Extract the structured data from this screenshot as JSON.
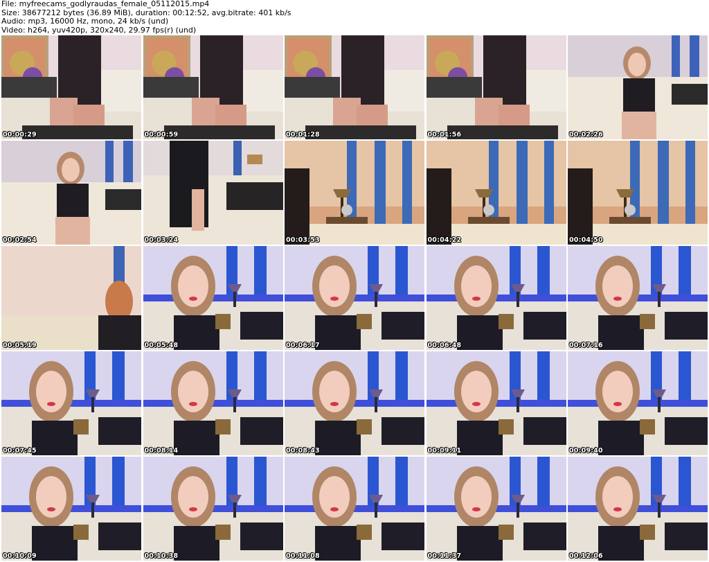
{
  "header": {
    "line1": "File: myfreecams_godlyraudas_female_05112015.mp4",
    "line2": "Size: 38677212 bytes (36.89 MiB), duration: 00:12:52, avg.bitrate: 401 kb/s",
    "line3": "Audio: mp3, 16000 Hz, mono, 24 kb/s (und)",
    "line4": "Video: h264, yuv420p, 320x240, 29.97 fps(r) (und)"
  },
  "thumbnails": [
    {
      "time": "00:00:29",
      "scene": "poster-couch"
    },
    {
      "time": "00:00:59",
      "scene": "poster-couch"
    },
    {
      "time": "00:01:28",
      "scene": "poster-couch"
    },
    {
      "time": "00:01:56",
      "scene": "poster-couch"
    },
    {
      "time": "00:02:26",
      "scene": "couch-seated"
    },
    {
      "time": "00:02:54",
      "scene": "couch-seated"
    },
    {
      "time": "00:03:24",
      "scene": "couch-standing"
    },
    {
      "time": "00:03:53",
      "scene": "wall-lamp"
    },
    {
      "time": "00:04:22",
      "scene": "wall-lamp"
    },
    {
      "time": "00:04:50",
      "scene": "wall-lamp"
    },
    {
      "time": "00:05:19",
      "scene": "curtain-couch"
    },
    {
      "time": "00:05:48",
      "scene": "blue-closeup"
    },
    {
      "time": "00:06:17",
      "scene": "blue-closeup"
    },
    {
      "time": "00:06:48",
      "scene": "blue-closeup"
    },
    {
      "time": "00:07:16",
      "scene": "blue-closeup"
    },
    {
      "time": "00:07:45",
      "scene": "blue-closeup"
    },
    {
      "time": "00:08:14",
      "scene": "blue-closeup"
    },
    {
      "time": "00:08:43",
      "scene": "blue-closeup"
    },
    {
      "time": "00:09:11",
      "scene": "blue-closeup"
    },
    {
      "time": "00:09:40",
      "scene": "blue-closeup"
    },
    {
      "time": "00:10:09",
      "scene": "blue-closeup"
    },
    {
      "time": "00:10:38",
      "scene": "blue-closeup"
    },
    {
      "time": "00:11:08",
      "scene": "blue-closeup"
    },
    {
      "time": "00:11:37",
      "scene": "blue-closeup"
    },
    {
      "time": "00:12:06",
      "scene": "blue-closeup"
    }
  ]
}
